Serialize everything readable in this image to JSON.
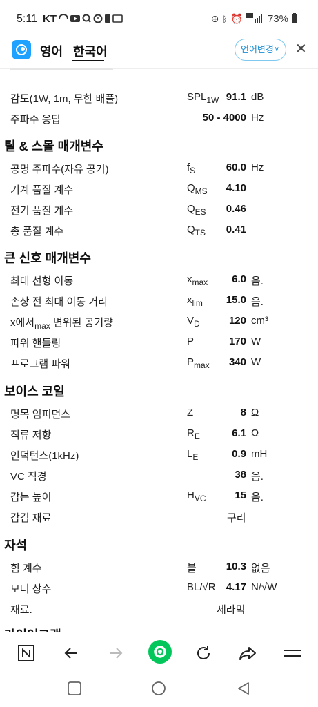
{
  "status": {
    "time": "5:11",
    "carrier": "KT",
    "battery": "73%"
  },
  "header": {
    "source_lang": "영어",
    "target_lang": "한국어",
    "change_lang": "언어변경"
  },
  "rows_top": [
    {
      "label": "감도(1W, 1m, 무한 배플)",
      "sym": "SPL",
      "sub": "1W",
      "val": "91.1",
      "unit": "dB"
    },
    {
      "label": "주파수 응답",
      "sym": "",
      "sub": "",
      "val": "50 - 4000",
      "unit": "Hz"
    }
  ],
  "sections": {
    "ts": "틸 & 스몰 매개변수",
    "large": "큰 신호 매개변수",
    "coil": "보이스 코일",
    "magnet": "자석"
  },
  "rows_ts": [
    {
      "label": "공명 주파수(자유 공기)",
      "sym": "f",
      "sub": "S",
      "val": "60.0",
      "unit": "Hz"
    },
    {
      "label": "기계 품질 계수",
      "sym": "Q",
      "sub": "MS",
      "val": "4.10",
      "unit": ""
    },
    {
      "label": "전기 품질 계수",
      "sym": "Q",
      "sub": "ES",
      "val": "0.46",
      "unit": ""
    },
    {
      "label": "총 품질 계수",
      "sym": "Q",
      "sub": "TS",
      "val": "0.41",
      "unit": ""
    }
  ],
  "rows_large": [
    {
      "label": "최대 선형 이동",
      "sym": "x",
      "sub": "max",
      "val": "6.0",
      "unit": "음."
    },
    {
      "label": "손상 전 최대 이동 거리",
      "sym": "x",
      "sub": "lim",
      "val": "15.0",
      "unit": "음."
    },
    {
      "label": "x에서",
      "label_sub": "max",
      "label_rest": " 변위된 공기량",
      "sym": "V",
      "sub": "D",
      "val": "120",
      "unit": "cm³"
    },
    {
      "label": "파워 핸들링",
      "sym": "P",
      "sub": "",
      "val": "170",
      "unit": "W"
    },
    {
      "label": "프로그램 파워",
      "sym": "P",
      "sub": "max",
      "val": "340",
      "unit": "W"
    }
  ],
  "rows_coil": [
    {
      "label": "명목 임피던스",
      "sym": "Z",
      "sub": "",
      "val": "8",
      "unit": "Ω"
    },
    {
      "label": "직류 저항",
      "sym": "R",
      "sub": "E",
      "val": "6.1",
      "unit": "Ω"
    },
    {
      "label": "인덕턴스(1kHz)",
      "sym": "L",
      "sub": "E",
      "val": "0.9",
      "unit": "mH"
    },
    {
      "label": "VC 직경",
      "sym": "",
      "sub": "",
      "val": "38",
      "unit": "음."
    },
    {
      "label": "감는 높이",
      "sym": "H",
      "sub": "VC",
      "val": "15",
      "unit": "음."
    },
    {
      "label": "감김 재료",
      "center": "구리"
    }
  ],
  "rows_magnet": [
    {
      "label": "힘 계수",
      "sym": "블",
      "sub": "",
      "val": "10.3",
      "unit": "없음"
    },
    {
      "label": "모터 상수",
      "sym": "BL/√R",
      "sub": "",
      "val": "4.17",
      "unit": "N/√W"
    },
    {
      "label": "재료.",
      "center": "세라믹"
    }
  ],
  "cutoff_heading": "라이어그램",
  "icons": {
    "browser": [
      "naver-icon",
      "back-arrow-icon",
      "forward-arrow-icon",
      "green-home-icon",
      "refresh-icon",
      "share-icon",
      "menu-icon"
    ],
    "system": [
      "recent-apps-icon",
      "home-icon",
      "back-icon"
    ]
  },
  "colors": {
    "accent": "#1ea1ff",
    "green": "#03c75a"
  }
}
